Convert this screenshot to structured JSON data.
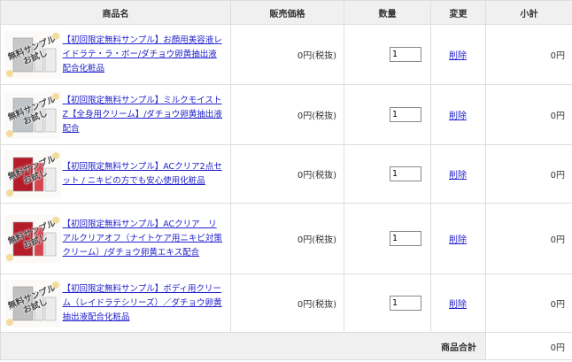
{
  "header": {
    "product_name": "商品名",
    "price": "販売価格",
    "quantity": "数量",
    "change": "変更",
    "subtotal": "小計"
  },
  "items": [
    {
      "name": "【初回限定無料サンプル】お顔用美容液レイドラテ・ラ・ボー/ダチョウ卵黄抽出液配合化粧品",
      "price": "0円(税抜)",
      "quantity": "1",
      "delete_label": "削除",
      "subtotal": "0円",
      "stamp": "無料サンプル",
      "stamp2": "お試し",
      "package_color": "#c8c8c8"
    },
    {
      "name": "【初回限定無料サンプル】ミルクモイストZ【全身用クリーム】/ダチョウ卵黄抽出液配合",
      "price": "0円(税抜)",
      "quantity": "1",
      "delete_label": "削除",
      "subtotal": "0円",
      "stamp": "無料サンプル",
      "stamp2": "お試し",
      "package_color": "#bfc4c8"
    },
    {
      "name": "【初回限定無料サンプル】ACクリア2点セット / ニキビの方でも安心使用化粧品",
      "price": "0円(税抜)",
      "quantity": "1",
      "delete_label": "削除",
      "subtotal": "0円",
      "stamp": "無料サンプル",
      "stamp2": "お試し",
      "package_color": "#b51c2a"
    },
    {
      "name": "【初回限定無料サンプル】ACクリア　リアルクリアオフ（ナイトケア用ニキビ対策クリーム）/ダチョウ卵黄エキス配合",
      "price": "0円(税抜)",
      "quantity": "1",
      "delete_label": "削除",
      "subtotal": "0円",
      "stamp": "無料サンプル",
      "stamp2": "お試し",
      "package_color": "#b51c2a"
    },
    {
      "name": "【初回限定無料サンプル】ボディ用クリーム（レイドラテシリーズ）／ダチョウ卵黄抽出液配合化粧品",
      "price": "0円(税抜)",
      "quantity": "1",
      "delete_label": "削除",
      "subtotal": "0円",
      "stamp": "無料サンプル",
      "stamp2": "お試し",
      "package_color": "#c0c0c0"
    }
  ],
  "totals": {
    "label": "商品合計",
    "value": "0円"
  }
}
